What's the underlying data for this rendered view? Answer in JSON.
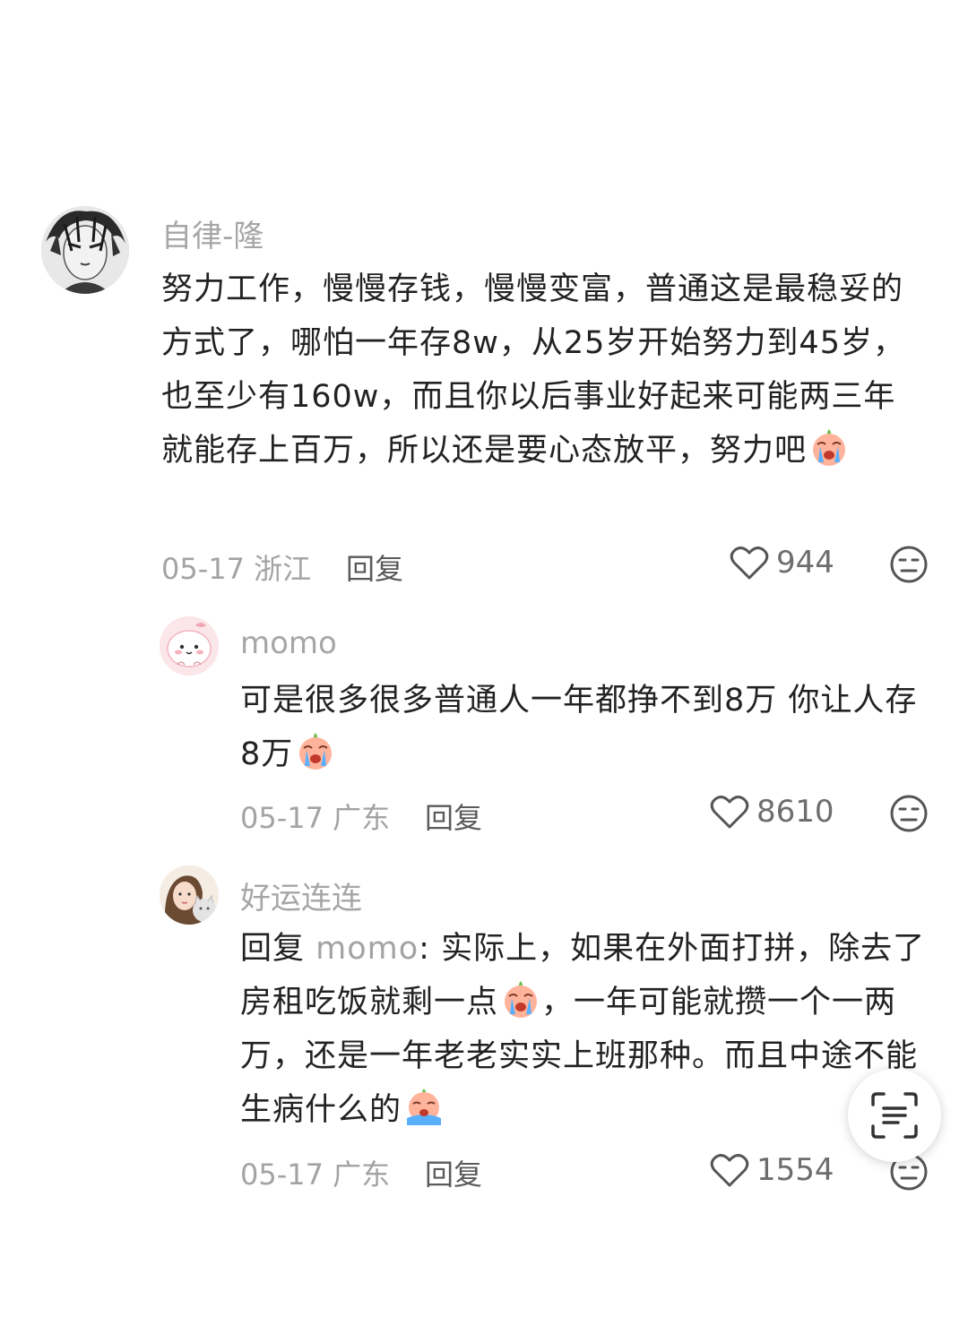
{
  "comments": [
    {
      "username": "自律-隆",
      "text": "努力工作，慢慢存钱，慢慢变富，普通这是最稳妥的方式了，哪怕一年存8w，从25岁开始努力到45岁，也至少有160w，而且你以后事业好起来可能两三年就能存上百万，所以还是要心态放平，努力吧",
      "date": "05-17",
      "location": "浙江",
      "reply_label": "回复",
      "likes": "944",
      "avatar_icon": "manga-portrait-avatar",
      "emoji_icon": "crying-peach-emoji"
    },
    {
      "username": "momo",
      "text": "可是很多很多普通人一年都挣不到8万 你让人存8万",
      "date": "05-17",
      "location": "广东",
      "reply_label": "回复",
      "likes": "8610",
      "avatar_icon": "pink-blob-avatar",
      "emoji_icon": "crying-peach-emoji"
    },
    {
      "username": "好运连连",
      "reply_prefix": "回复",
      "reply_to": "momo",
      "text_part1": ": 实际上，如果在外面打拼，除去了房租吃饭就剩一点",
      "text_part2": "，一年可能就攒一个一两万，还是一年老老实实上班那种。而且中途不能生病什么的",
      "date": "05-17",
      "location": "广东",
      "reply_label": "回复",
      "likes": "1554",
      "avatar_icon": "girl-with-cat-avatar",
      "emoji_icon": "crying-peach-emoji"
    }
  ],
  "colors": {
    "username": "#a6a6a6",
    "text": "#222222",
    "meta": "#a3a3a3"
  }
}
